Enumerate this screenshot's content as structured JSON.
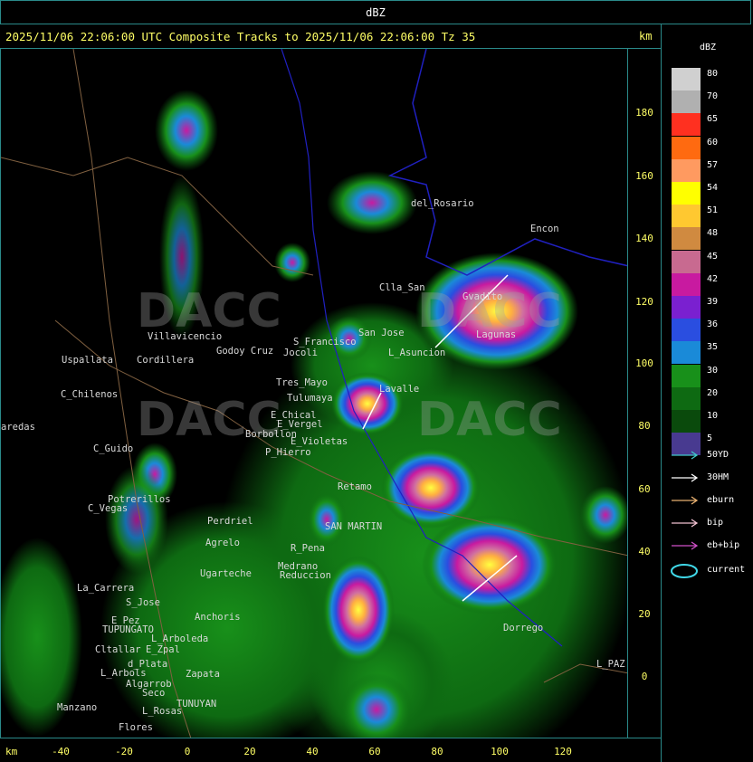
{
  "window": {
    "title": "dBZ"
  },
  "header": {
    "text": "2025/11/06 22:06:00 UTC Composite Tracks to 2025/11/06 22:06:00 Tz 35",
    "km_label": "km"
  },
  "y_axis": {
    "unit": "km",
    "ticks": [
      "180",
      "160",
      "140",
      "120",
      "100",
      "80",
      "60",
      "40",
      "20",
      "0"
    ]
  },
  "x_axis": {
    "unit": "km",
    "ticks": [
      "-40",
      "-20",
      "0",
      "20",
      "40",
      "60",
      "80",
      "100",
      "120"
    ]
  },
  "legend": {
    "title": "dBZ",
    "levels": [
      {
        "label": "80",
        "color": "#d0d0d0"
      },
      {
        "label": "70",
        "color": "#b0b0b0"
      },
      {
        "label": "65",
        "color": "#ff3020"
      },
      {
        "label": "60",
        "color": "#ff6a10"
      },
      {
        "label": "57",
        "color": "#ff9a60"
      },
      {
        "label": "54",
        "color": "#ffff00"
      },
      {
        "label": "51",
        "color": "#ffc830"
      },
      {
        "label": "48",
        "color": "#d08a40"
      },
      {
        "label": "45",
        "color": "#c86a90"
      },
      {
        "label": "42",
        "color": "#c81aa0"
      },
      {
        "label": "39",
        "color": "#7a20d0"
      },
      {
        "label": "36",
        "color": "#2a4ee0"
      },
      {
        "label": "35",
        "color": "#1a8ad8"
      },
      {
        "label": "30",
        "color": "#18901a"
      },
      {
        "label": "20",
        "color": "#0e6a12"
      },
      {
        "label": "10",
        "color": "#0a4a0c"
      },
      {
        "label": "5",
        "color": "#483a90"
      }
    ],
    "tracks": [
      {
        "label": "50YD",
        "color": "#40c8c8"
      },
      {
        "label": "30HM",
        "color": "#ffffff"
      },
      {
        "label": "eburn",
        "color": "#e8b070"
      },
      {
        "label": "bip",
        "color": "#f0c0d0"
      },
      {
        "label": "eb+bip",
        "color": "#d050c8"
      }
    ],
    "current": {
      "label": "current",
      "color": "#40d8e8"
    }
  },
  "places": [
    {
      "name": "Uspallata"
    },
    {
      "name": "C_Chilenos"
    },
    {
      "name": "aredas"
    },
    {
      "name": "C_Guido"
    },
    {
      "name": "Villavicencio"
    },
    {
      "name": "Godoy Cruz"
    },
    {
      "name": "S_Francisco"
    },
    {
      "name": "Jocoli"
    },
    {
      "name": "Tres_Mayo"
    },
    {
      "name": "Tulumaya"
    },
    {
      "name": "E_Chical"
    },
    {
      "name": "E_Vergel"
    },
    {
      "name": "Borbollon"
    },
    {
      "name": "P_Hierro"
    },
    {
      "name": "E_Violetas"
    },
    {
      "name": "del_Rosario"
    },
    {
      "name": "Encon"
    },
    {
      "name": "Clla_San"
    },
    {
      "name": "Gvadito"
    },
    {
      "name": "San Jose"
    },
    {
      "name": "L_Asuncion"
    },
    {
      "name": "Cordillera"
    },
    {
      "name": "Lagunas"
    },
    {
      "name": "Potrerillos"
    },
    {
      "name": "C_Vegas"
    },
    {
      "name": "Perdriel"
    },
    {
      "name": "Agrelo"
    },
    {
      "name": "Ugarteche"
    },
    {
      "name": "R_Pena"
    },
    {
      "name": "Medrano"
    },
    {
      "name": "Reduccion"
    },
    {
      "name": "SAN MARTIN"
    },
    {
      "name": "La_Carrera"
    },
    {
      "name": "S_Jose"
    },
    {
      "name": "E_Pez"
    },
    {
      "name": "TUPUNGATO"
    },
    {
      "name": "Anchoris"
    },
    {
      "name": "L_Arboleda"
    },
    {
      "name": "Cltallar"
    },
    {
      "name": "E_Zpal"
    },
    {
      "name": "d_Plata"
    },
    {
      "name": "L_Arbols"
    },
    {
      "name": "Zapata"
    },
    {
      "name": "Algarrob"
    },
    {
      "name": "Seco"
    },
    {
      "name": "TUNUYAN"
    },
    {
      "name": "Manzano"
    },
    {
      "name": "L_Rosas"
    },
    {
      "name": "Flores"
    },
    {
      "name": "Dorrego"
    },
    {
      "name": "L_PAZ"
    },
    {
      "name": "Retamo"
    },
    {
      "name": "Lavalle"
    }
  ],
  "watermark": {
    "text": "DACC"
  }
}
